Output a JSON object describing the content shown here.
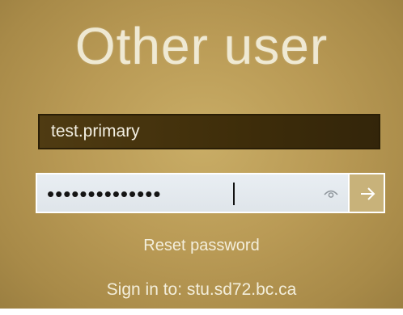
{
  "login": {
    "title": "Other user",
    "username_value": "test.primary",
    "password_masked": "••••••••••••••",
    "reset_password_label": "Reset password",
    "sign_in_to_label": "Sign in to: stu.sd72.bc.ca"
  },
  "icons": {
    "reveal": "eye-icon",
    "submit": "arrow-right-icon"
  },
  "colors": {
    "background": "#b99a55",
    "username_field": "#3e2d0a",
    "password_field": "#e4e9ee",
    "submit_button": "#c8b27a",
    "text_light": "#f3eedb"
  }
}
